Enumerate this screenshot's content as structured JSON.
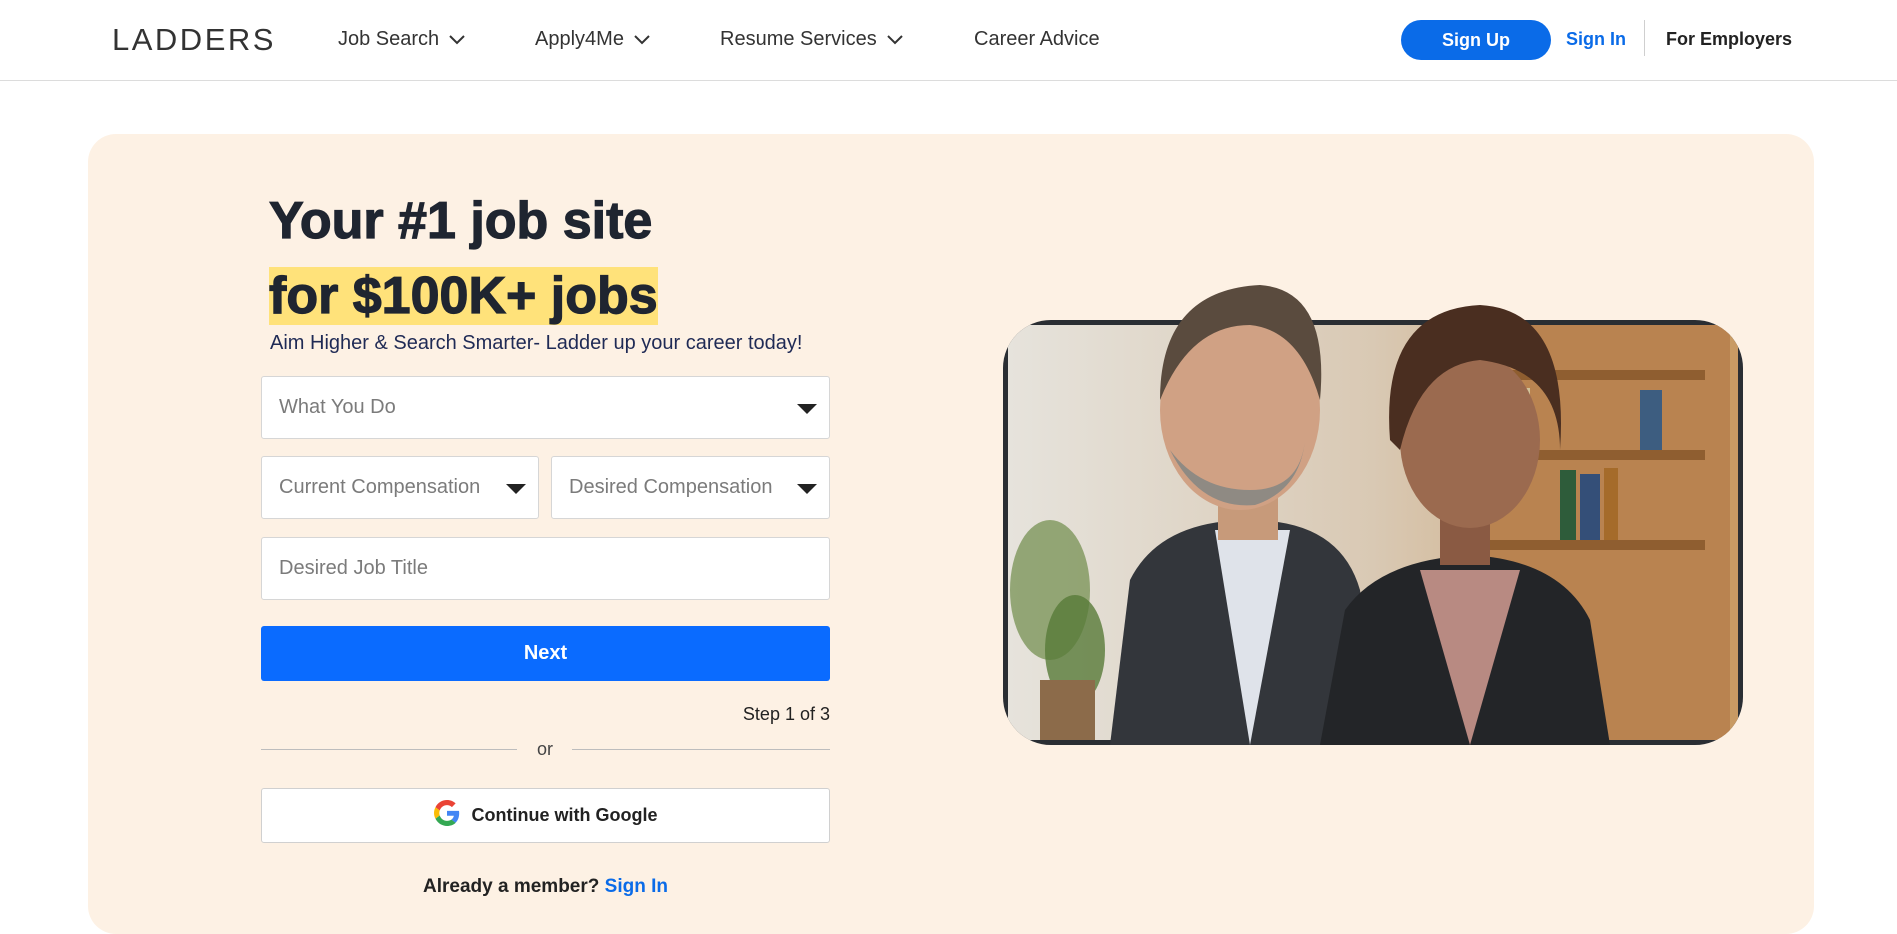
{
  "header": {
    "logo": "LADDERS",
    "nav": [
      {
        "label": "Job Search",
        "has_dropdown": true
      },
      {
        "label": "Apply4Me",
        "has_dropdown": true
      },
      {
        "label": "Resume Services",
        "has_dropdown": true
      },
      {
        "label": "Career Advice",
        "has_dropdown": false
      }
    ],
    "sign_up": "Sign Up",
    "sign_in": "Sign In",
    "for_employers": "For Employers"
  },
  "hero": {
    "headline_line1": "Your #1 job site",
    "headline_line2": "for $100K+ jobs",
    "subheadline": "Aim Higher & Search Smarter- Ladder up your career today!",
    "form": {
      "what_you_do": "What You Do",
      "current_compensation": "Current Compensation",
      "desired_compensation": "Desired Compensation",
      "desired_job_title_placeholder": "Desired Job Title",
      "next_button": "Next",
      "step": "Step 1 of 3",
      "or": "or",
      "google_button": "Continue with Google",
      "already_member": "Already a member?",
      "sign_in_link": "Sign In"
    },
    "image_icon": "professionals-photo"
  },
  "colors": {
    "accent_blue": "#0a6be8",
    "hero_bg": "#fdf1e4",
    "highlight": "#ffe27a"
  }
}
